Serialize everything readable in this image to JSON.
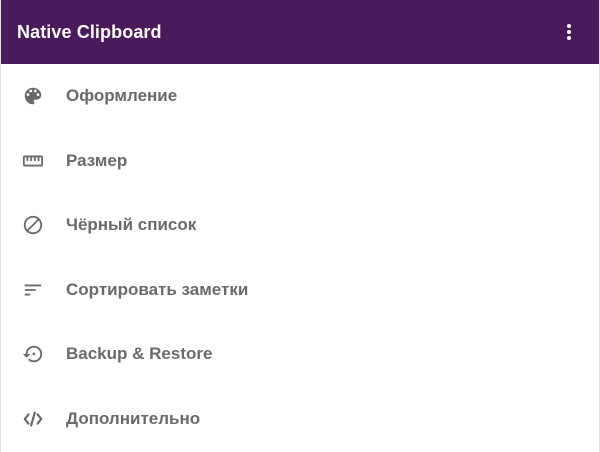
{
  "app_bar": {
    "title": "Native Clipboard",
    "menu_icon": "more-vert-icon",
    "background": "#4a1a5c"
  },
  "settings": {
    "items": [
      {
        "label": "Оформление",
        "icon": "palette-icon"
      },
      {
        "label": "Размер",
        "icon": "ruler-icon"
      },
      {
        "label": "Чёрный список",
        "icon": "block-icon"
      },
      {
        "label": "Сортировать заметки",
        "icon": "sort-icon"
      },
      {
        "label": "Backup & Restore",
        "icon": "restore-icon"
      },
      {
        "label": "Дополнительно",
        "icon": "code-icon"
      }
    ]
  },
  "colors": {
    "icon": "#6a6a6a",
    "label": "#6a6a6a"
  }
}
